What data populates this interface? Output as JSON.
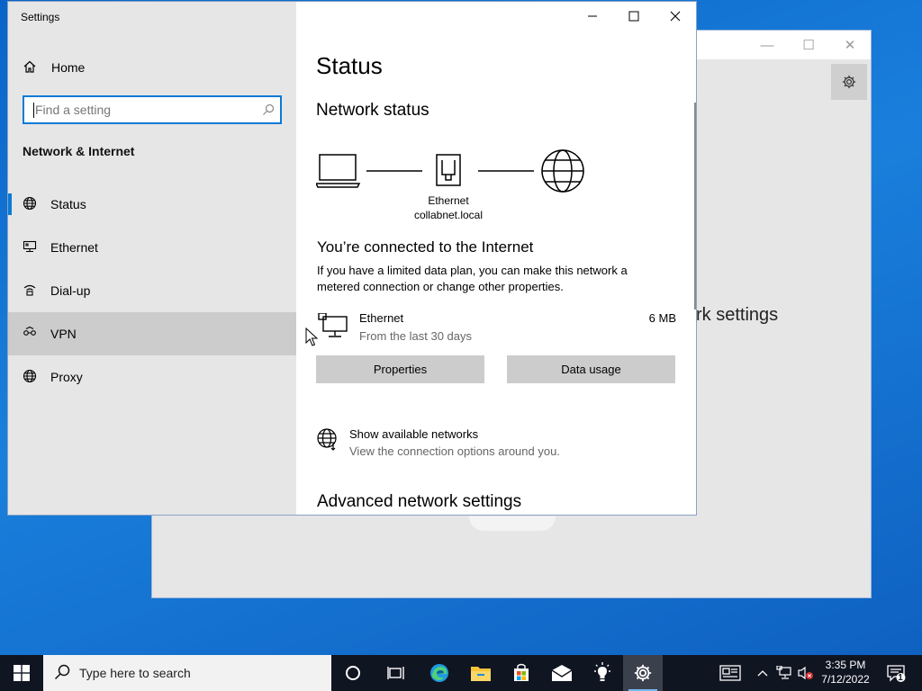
{
  "background_window": {
    "partial_heading": "rk settings"
  },
  "window": {
    "app_title": "Settings",
    "home_label": "Home",
    "search_placeholder": "Find a setting",
    "section_title": "Network & Internet",
    "nav": [
      {
        "label": "Status",
        "icon": "globe-icon",
        "selected": true
      },
      {
        "label": "Ethernet",
        "icon": "ethernet-icon"
      },
      {
        "label": "Dial-up",
        "icon": "dialup-icon"
      },
      {
        "label": "VPN",
        "icon": "vpn-icon",
        "hover": true
      },
      {
        "label": "Proxy",
        "icon": "globe-icon"
      }
    ]
  },
  "content": {
    "page_title": "Status",
    "network_status_title": "Network status",
    "adapter_name": "Ethernet",
    "domain": "collabnet.local",
    "connected_title": "You’re connected to the Internet",
    "connected_desc": "If you have a limited data plan, you can make this network a metered connection or change other properties.",
    "ethernet": {
      "name": "Ethernet",
      "subtitle": "From the last 30 days",
      "usage": "6 MB"
    },
    "buttons": {
      "properties": "Properties",
      "data_usage": "Data usage"
    },
    "show_networks": {
      "title": "Show available networks",
      "subtitle": "View the connection options around you."
    },
    "advanced_title": "Advanced network settings"
  },
  "taskbar": {
    "search_placeholder": "Type here to search",
    "time": "3:35 PM",
    "date": "7/12/2022",
    "notification_count": "1"
  },
  "colors": {
    "accent": "#0a7ad6",
    "sidebar_bg": "#e6e6e6",
    "desktop": "#0a64c8",
    "taskbar": "#101522"
  }
}
